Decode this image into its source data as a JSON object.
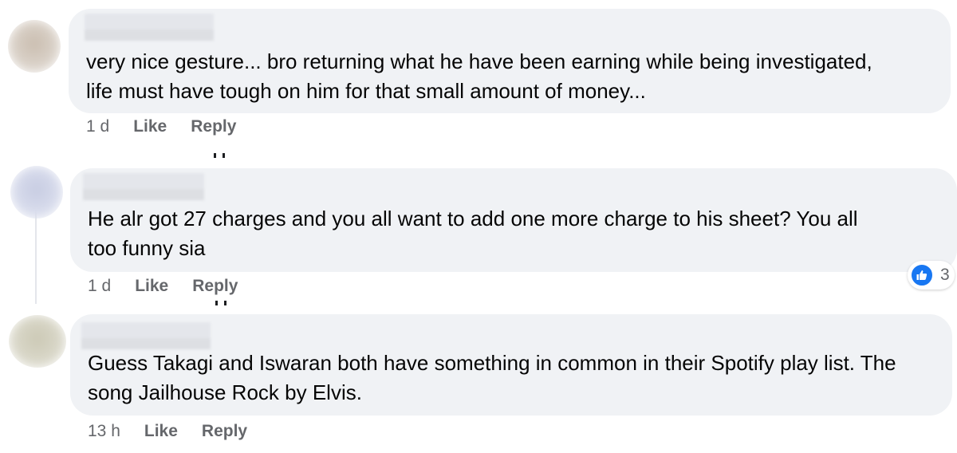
{
  "comments": [
    {
      "text": "very nice gesture... bro returning what he have been earning while being investigated,\nlife must have tough on him for that small amount of money...",
      "time": "1 d",
      "like_label": "Like",
      "reply_label": "Reply"
    },
    {
      "text": "He alr got 27 charges and you all want to add one more charge to his sheet? You all\ntoo funny sia",
      "time": "1 d",
      "like_label": "Like",
      "reply_label": "Reply",
      "reaction_count": "3"
    },
    {
      "text": "Guess Takagi and Iswaran both have something in common in their Spotify play list. The\nsong Jailhouse Rock by Elvis.",
      "time": "13 h",
      "like_label": "Like",
      "reply_label": "Reply"
    }
  ],
  "colors": {
    "bubble": "#f0f2f5",
    "meta_text": "#65676b",
    "like_blue": "#1877f2"
  },
  "icons": {
    "reaction": "like-reaction-icon"
  }
}
